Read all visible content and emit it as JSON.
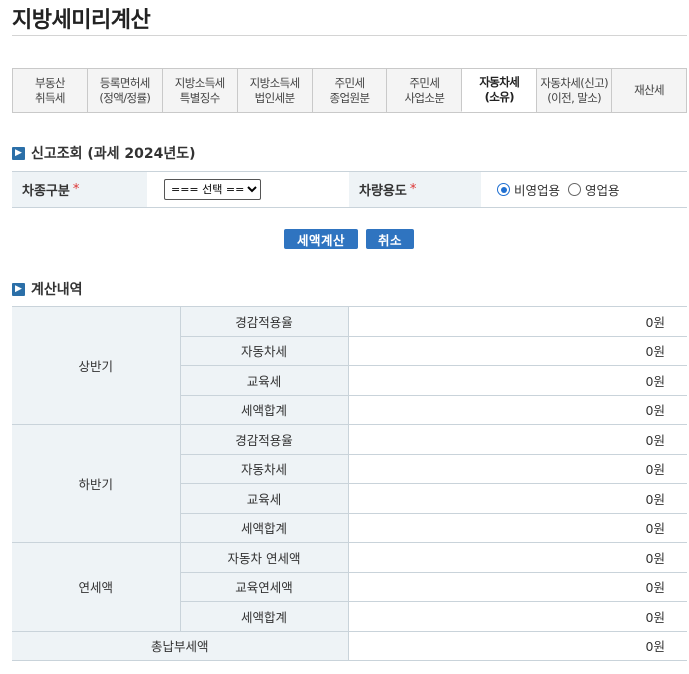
{
  "page": {
    "title": "지방세미리계산"
  },
  "tabs": [
    {
      "label": "부동산\n취득세",
      "active": false
    },
    {
      "label": "등록면허세\n(정액/정률)",
      "active": false
    },
    {
      "label": "지방소득세\n특별징수",
      "active": false
    },
    {
      "label": "지방소득세\n법인세분",
      "active": false
    },
    {
      "label": "주민세\n종업원분",
      "active": false
    },
    {
      "label": "주민세\n사업소분",
      "active": false
    },
    {
      "label": "자동차세\n(소유)",
      "active": true
    },
    {
      "label": "자동차세(신고)\n(이전, 말소)",
      "active": false
    },
    {
      "label": "재산세",
      "active": false
    }
  ],
  "report": {
    "section_title": "신고조회 (과세 2024년도)",
    "vehicle_type_label": "차종구분",
    "vehicle_type_select": "=== 선택 ===",
    "usage_label": "차량용도",
    "required_mark": "*",
    "radio_nonbusiness": "비영업용",
    "radio_business": "영업용",
    "selected_usage": "비영업용"
  },
  "buttons": {
    "calculate": "세액계산",
    "cancel": "취소"
  },
  "calc": {
    "section_title": "계산내역",
    "first_half": {
      "group": "상반기",
      "rows": [
        {
          "label": "경감적용율",
          "value": "0원"
        },
        {
          "label": "자동차세",
          "value": "0원"
        },
        {
          "label": "교육세",
          "value": "0원"
        },
        {
          "label": "세액합계",
          "value": "0원"
        }
      ]
    },
    "second_half": {
      "group": "하반기",
      "rows": [
        {
          "label": "경감적용율",
          "value": "0원"
        },
        {
          "label": "자동차세",
          "value": "0원"
        },
        {
          "label": "교육세",
          "value": "0원"
        },
        {
          "label": "세액합계",
          "value": "0원"
        }
      ]
    },
    "annual": {
      "group": "연세액",
      "rows": [
        {
          "label": "자동차 연세액",
          "value": "0원"
        },
        {
          "label": "교육연세액",
          "value": "0원"
        },
        {
          "label": "세액합계",
          "value": "0원"
        }
      ]
    },
    "total": {
      "label": "총납부세액",
      "value": "0원"
    }
  },
  "icons": {
    "section_icon": "chevron-right-icon"
  },
  "colors": {
    "accent": "#2f74c0",
    "header_bg": "#eef3f6",
    "border": "#c9d3da"
  }
}
